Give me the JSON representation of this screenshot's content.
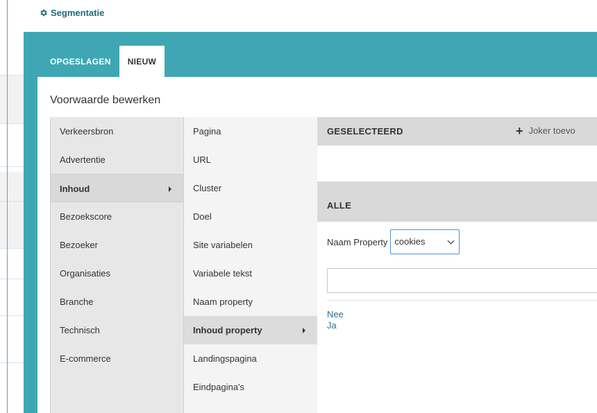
{
  "header": {
    "title": "Segmentatie",
    "icon": "gear-icon"
  },
  "tabs": [
    {
      "label": "OPGESLAGEN",
      "active": false
    },
    {
      "label": "NIEUW",
      "active": true
    }
  ],
  "panel": {
    "title": "Voorwaarde bewerken"
  },
  "categories": [
    {
      "label": "Verkeersbron"
    },
    {
      "label": "Advertentie"
    },
    {
      "label": "Inhoud",
      "selected": true
    },
    {
      "label": "Bezoekscore"
    },
    {
      "label": "Bezoeker"
    },
    {
      "label": "Organisaties"
    },
    {
      "label": "Branche"
    },
    {
      "label": "Technisch"
    },
    {
      "label": "E-commerce"
    }
  ],
  "subcategories": [
    {
      "label": "Pagina"
    },
    {
      "label": "URL"
    },
    {
      "label": "Cluster"
    },
    {
      "label": "Doel"
    },
    {
      "label": "Site variabelen"
    },
    {
      "label": "Variabele tekst"
    },
    {
      "label": "Naam property"
    },
    {
      "label": "Inhoud property",
      "selected": true
    },
    {
      "label": "Landingspagina"
    },
    {
      "label": "Eindpagina's"
    }
  ],
  "selected_section": {
    "heading": "GESELECTEERD",
    "joker_label": "Joker toevo"
  },
  "all_section": {
    "heading": "ALLE",
    "property_label": "Naam Property",
    "property_value": "cookies",
    "filter_value": "",
    "values": [
      "Nee",
      "Ja"
    ]
  },
  "colors": {
    "teal": "#3ea7b3",
    "link": "#2b6c8a",
    "title": "#1d6a72"
  }
}
